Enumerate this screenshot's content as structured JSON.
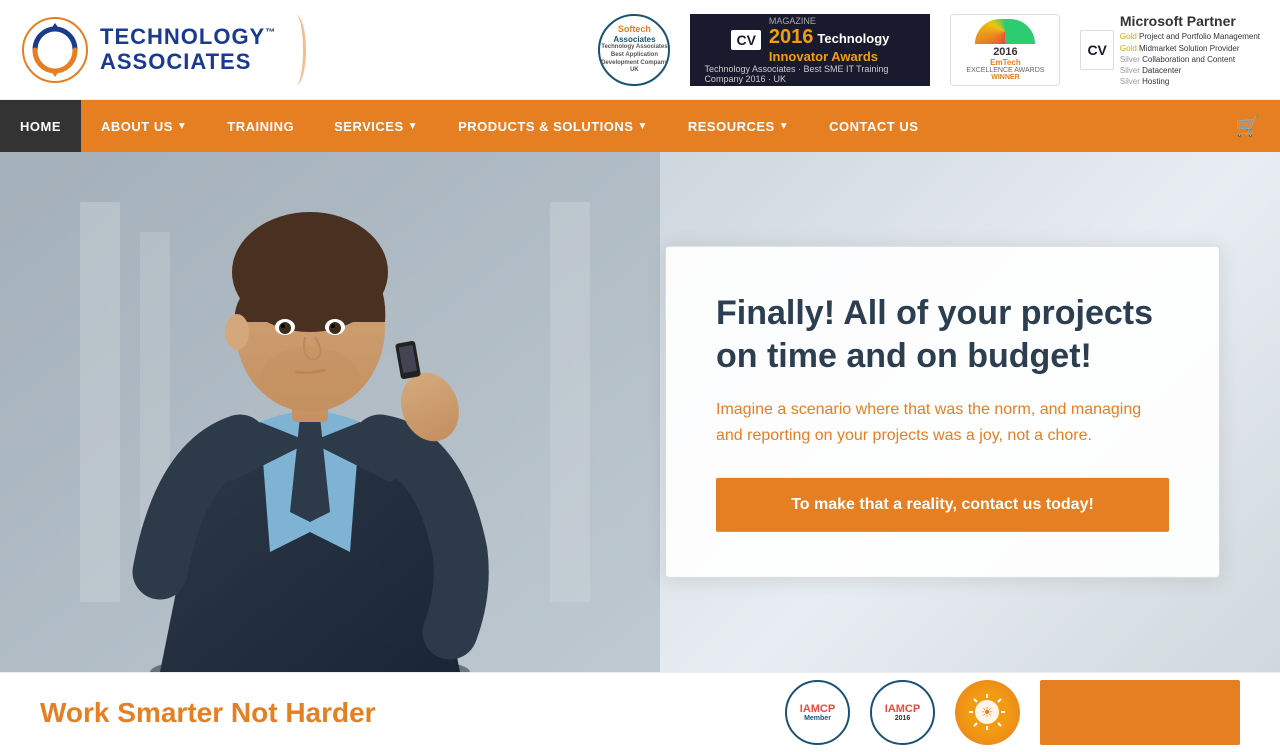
{
  "header": {
    "logo": {
      "text_line1": "TECHNOLOGY",
      "tm": "™",
      "text_line2": "ASSOCIATES"
    },
    "badges": {
      "softech": {
        "title": "Softech",
        "subtitle": "Associates",
        "line1": "Technology Associates",
        "line2": "Best Application",
        "line3": "Development Company UK"
      },
      "cv_award": {
        "cv_label": "CV",
        "year": "2016",
        "magazine": "MAGAZINE",
        "title": "Technology",
        "subtitle": "Innovator Awards",
        "winner": "Technology Associates",
        "winner_sub": "Best SME IT Training Company 2016 · UK"
      },
      "emtech": {
        "year": "2016",
        "title": "EmTech",
        "subtitle": "EXCELLENCE AWARDS",
        "label": "WINNER"
      },
      "microsoft": {
        "cv_label": "CV",
        "partner_title": "Microsoft Partner",
        "gold1": "Gold  Project and Portfolio Management",
        "gold2": "Gold  Midmarket Solution Provider",
        "silver1": "Silver  Collaboration and Content",
        "silver2": "Silver  Datacenter",
        "silver3": "Silver  Hosting"
      }
    }
  },
  "nav": {
    "items": [
      {
        "label": "HOME",
        "active": true,
        "has_arrow": false
      },
      {
        "label": "ABOUT US",
        "active": false,
        "has_arrow": true
      },
      {
        "label": "TRAINING",
        "active": false,
        "has_arrow": false
      },
      {
        "label": "SERVICES",
        "active": false,
        "has_arrow": true
      },
      {
        "label": "PRODUCTS & SOLUTIONS",
        "active": false,
        "has_arrow": true
      },
      {
        "label": "RESOURCES",
        "active": false,
        "has_arrow": true
      },
      {
        "label": "CONTACT US",
        "active": false,
        "has_arrow": false
      }
    ],
    "cart_icon": "🛒"
  },
  "hero": {
    "heading": "Finally! All of your projects on time and on budget!",
    "subtext": "Imagine a scenario where that was the norm, and managing and reporting on your projects was a joy, not a chore.",
    "cta_label": "To make that a reality, contact us today!"
  },
  "bottom": {
    "text": "Work Smarter Not Harder",
    "orange_block": ""
  }
}
